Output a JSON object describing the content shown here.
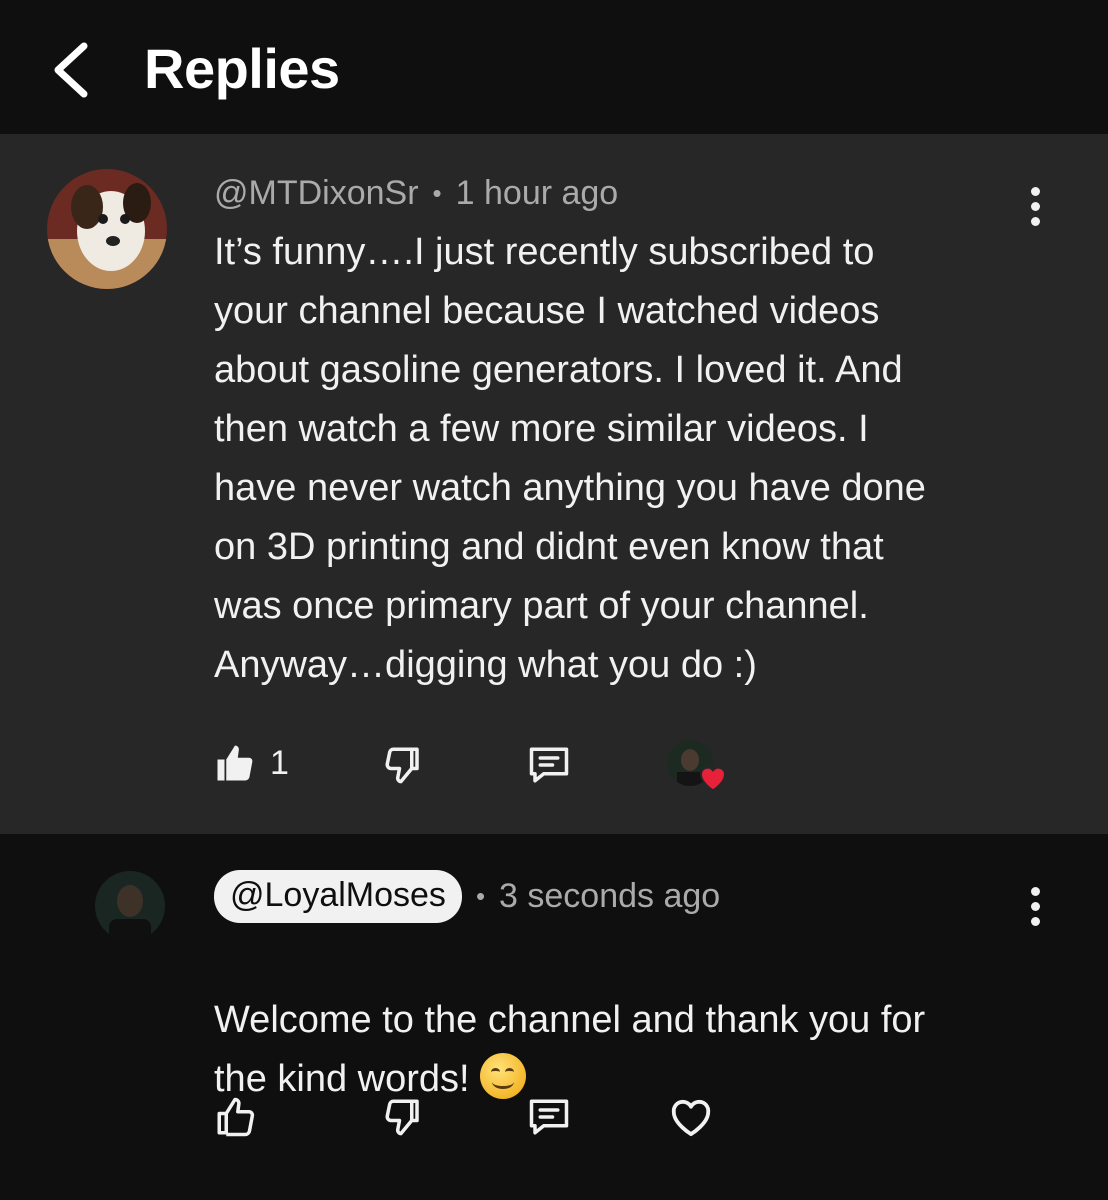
{
  "header": {
    "title": "Replies",
    "back_icon": "chevron-left-icon"
  },
  "parent_comment": {
    "author": "@MTDixonSr",
    "time": "1 hour ago",
    "text": "It’s funny….I just recently subscribed to\nyour channel because I watched videos\nabout gasoline generators. I loved it. And\nthen watch a few more similar videos. I\nhave never watch anything you have done\non 3D printing and didnt even know that\nwas once  primary part of your channel.\nAnyway…digging what you do :)",
    "like_count": "1",
    "liked": true,
    "creator_hearted": true
  },
  "reply": {
    "author": "@LoyalMoses",
    "time": "3 seconds ago",
    "text": "Welcome to the channel and thank you for\nthe kind words! ",
    "emoji": "smiling-face-emoji"
  },
  "colors": {
    "background": "#0f0f0f",
    "parent_background": "#272727",
    "text_primary": "#f1f1f1",
    "text_secondary": "#aaaaaa",
    "heart_red": "#e8213b"
  }
}
